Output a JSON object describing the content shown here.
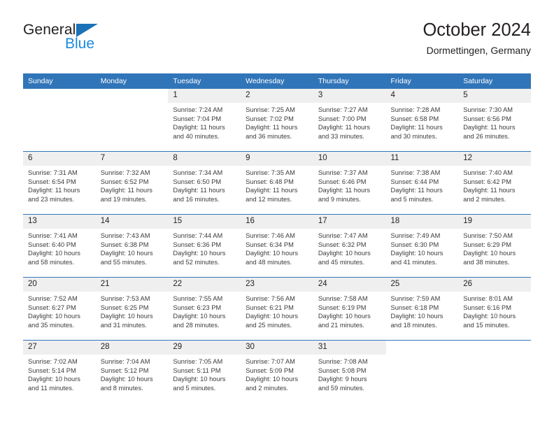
{
  "brand": {
    "name_top": "General",
    "name_bottom": "Blue",
    "triangle_color": "#1b72b8",
    "bottom_color": "#1b8ae0"
  },
  "header": {
    "title": "October 2024",
    "subtitle": "Dormettingen, Germany"
  },
  "theme": {
    "header_blue": "#3175b9",
    "daynum_band": "#efefef",
    "text": "#231f20",
    "body_text": "#3b3b3b"
  },
  "weekdays": [
    "Sunday",
    "Monday",
    "Tuesday",
    "Wednesday",
    "Thursday",
    "Friday",
    "Saturday"
  ],
  "weeks": [
    [
      {
        "day": "",
        "blank": true,
        "lines": []
      },
      {
        "day": "",
        "blank": true,
        "lines": []
      },
      {
        "day": "1",
        "lines": [
          "Sunrise: 7:24 AM",
          "Sunset: 7:04 PM",
          "Daylight: 11 hours",
          "and 40 minutes."
        ]
      },
      {
        "day": "2",
        "lines": [
          "Sunrise: 7:25 AM",
          "Sunset: 7:02 PM",
          "Daylight: 11 hours",
          "and 36 minutes."
        ]
      },
      {
        "day": "3",
        "lines": [
          "Sunrise: 7:27 AM",
          "Sunset: 7:00 PM",
          "Daylight: 11 hours",
          "and 33 minutes."
        ]
      },
      {
        "day": "4",
        "lines": [
          "Sunrise: 7:28 AM",
          "Sunset: 6:58 PM",
          "Daylight: 11 hours",
          "and 30 minutes."
        ]
      },
      {
        "day": "5",
        "lines": [
          "Sunrise: 7:30 AM",
          "Sunset: 6:56 PM",
          "Daylight: 11 hours",
          "and 26 minutes."
        ]
      }
    ],
    [
      {
        "day": "6",
        "lines": [
          "Sunrise: 7:31 AM",
          "Sunset: 6:54 PM",
          "Daylight: 11 hours",
          "and 23 minutes."
        ]
      },
      {
        "day": "7",
        "lines": [
          "Sunrise: 7:32 AM",
          "Sunset: 6:52 PM",
          "Daylight: 11 hours",
          "and 19 minutes."
        ]
      },
      {
        "day": "8",
        "lines": [
          "Sunrise: 7:34 AM",
          "Sunset: 6:50 PM",
          "Daylight: 11 hours",
          "and 16 minutes."
        ]
      },
      {
        "day": "9",
        "lines": [
          "Sunrise: 7:35 AM",
          "Sunset: 6:48 PM",
          "Daylight: 11 hours",
          "and 12 minutes."
        ]
      },
      {
        "day": "10",
        "lines": [
          "Sunrise: 7:37 AM",
          "Sunset: 6:46 PM",
          "Daylight: 11 hours",
          "and 9 minutes."
        ]
      },
      {
        "day": "11",
        "lines": [
          "Sunrise: 7:38 AM",
          "Sunset: 6:44 PM",
          "Daylight: 11 hours",
          "and 5 minutes."
        ]
      },
      {
        "day": "12",
        "lines": [
          "Sunrise: 7:40 AM",
          "Sunset: 6:42 PM",
          "Daylight: 11 hours",
          "and 2 minutes."
        ]
      }
    ],
    [
      {
        "day": "13",
        "lines": [
          "Sunrise: 7:41 AM",
          "Sunset: 6:40 PM",
          "Daylight: 10 hours",
          "and 58 minutes."
        ]
      },
      {
        "day": "14",
        "lines": [
          "Sunrise: 7:43 AM",
          "Sunset: 6:38 PM",
          "Daylight: 10 hours",
          "and 55 minutes."
        ]
      },
      {
        "day": "15",
        "lines": [
          "Sunrise: 7:44 AM",
          "Sunset: 6:36 PM",
          "Daylight: 10 hours",
          "and 52 minutes."
        ]
      },
      {
        "day": "16",
        "lines": [
          "Sunrise: 7:46 AM",
          "Sunset: 6:34 PM",
          "Daylight: 10 hours",
          "and 48 minutes."
        ]
      },
      {
        "day": "17",
        "lines": [
          "Sunrise: 7:47 AM",
          "Sunset: 6:32 PM",
          "Daylight: 10 hours",
          "and 45 minutes."
        ]
      },
      {
        "day": "18",
        "lines": [
          "Sunrise: 7:49 AM",
          "Sunset: 6:30 PM",
          "Daylight: 10 hours",
          "and 41 minutes."
        ]
      },
      {
        "day": "19",
        "lines": [
          "Sunrise: 7:50 AM",
          "Sunset: 6:29 PM",
          "Daylight: 10 hours",
          "and 38 minutes."
        ]
      }
    ],
    [
      {
        "day": "20",
        "lines": [
          "Sunrise: 7:52 AM",
          "Sunset: 6:27 PM",
          "Daylight: 10 hours",
          "and 35 minutes."
        ]
      },
      {
        "day": "21",
        "lines": [
          "Sunrise: 7:53 AM",
          "Sunset: 6:25 PM",
          "Daylight: 10 hours",
          "and 31 minutes."
        ]
      },
      {
        "day": "22",
        "lines": [
          "Sunrise: 7:55 AM",
          "Sunset: 6:23 PM",
          "Daylight: 10 hours",
          "and 28 minutes."
        ]
      },
      {
        "day": "23",
        "lines": [
          "Sunrise: 7:56 AM",
          "Sunset: 6:21 PM",
          "Daylight: 10 hours",
          "and 25 minutes."
        ]
      },
      {
        "day": "24",
        "lines": [
          "Sunrise: 7:58 AM",
          "Sunset: 6:19 PM",
          "Daylight: 10 hours",
          "and 21 minutes."
        ]
      },
      {
        "day": "25",
        "lines": [
          "Sunrise: 7:59 AM",
          "Sunset: 6:18 PM",
          "Daylight: 10 hours",
          "and 18 minutes."
        ]
      },
      {
        "day": "26",
        "lines": [
          "Sunrise: 8:01 AM",
          "Sunset: 6:16 PM",
          "Daylight: 10 hours",
          "and 15 minutes."
        ]
      }
    ],
    [
      {
        "day": "27",
        "lines": [
          "Sunrise: 7:02 AM",
          "Sunset: 5:14 PM",
          "Daylight: 10 hours",
          "and 11 minutes."
        ]
      },
      {
        "day": "28",
        "lines": [
          "Sunrise: 7:04 AM",
          "Sunset: 5:12 PM",
          "Daylight: 10 hours",
          "and 8 minutes."
        ]
      },
      {
        "day": "29",
        "lines": [
          "Sunrise: 7:05 AM",
          "Sunset: 5:11 PM",
          "Daylight: 10 hours",
          "and 5 minutes."
        ]
      },
      {
        "day": "30",
        "lines": [
          "Sunrise: 7:07 AM",
          "Sunset: 5:09 PM",
          "Daylight: 10 hours",
          "and 2 minutes."
        ]
      },
      {
        "day": "31",
        "lines": [
          "Sunrise: 7:08 AM",
          "Sunset: 5:08 PM",
          "Daylight: 9 hours",
          "and 59 minutes."
        ]
      },
      {
        "day": "",
        "blank": true,
        "lines": []
      },
      {
        "day": "",
        "blank": true,
        "lines": []
      }
    ]
  ]
}
